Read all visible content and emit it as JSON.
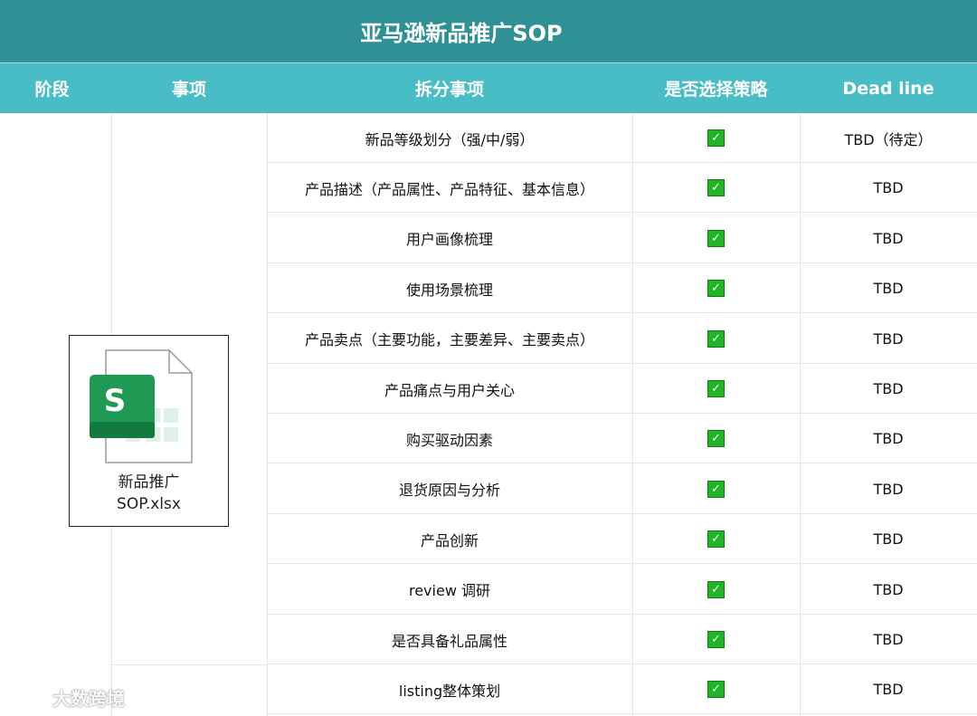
{
  "title": "亚马逊新品推广SOP",
  "headers": {
    "stage": "阶段",
    "item": "事项",
    "subtask": "拆分事项",
    "strategy": "是否选择策略",
    "deadline": "Dead line"
  },
  "rows": [
    {
      "task": "新品等级划分（强/中/弱）",
      "checked": true,
      "deadline": "TBD（待定）"
    },
    {
      "task": "产品描述（产品属性、产品特征、基本信息）",
      "checked": true,
      "deadline": "TBD"
    },
    {
      "task": "用户画像梳理",
      "checked": true,
      "deadline": "TBD"
    },
    {
      "task": "使用场景梳理",
      "checked": true,
      "deadline": "TBD"
    },
    {
      "task": "产品卖点（主要功能，主要差异、主要卖点）",
      "checked": true,
      "deadline": "TBD"
    },
    {
      "task": "产品痛点与用户关心",
      "checked": true,
      "deadline": "TBD"
    },
    {
      "task": "购买驱动因素",
      "checked": true,
      "deadline": "TBD"
    },
    {
      "task": "退货原因与分析",
      "checked": true,
      "deadline": "TBD"
    },
    {
      "task": "产品创新",
      "checked": true,
      "deadline": "TBD"
    },
    {
      "task": "review 调研",
      "checked": true,
      "deadline": "TBD"
    },
    {
      "task": "是否具备礼品属性",
      "checked": true,
      "deadline": "TBD"
    },
    {
      "task": "listing整体策划",
      "checked": true,
      "deadline": "TBD"
    }
  ],
  "check_mark": "✓",
  "attachment": {
    "line1": "新品推广",
    "line2": "SOP.xlsx",
    "icon_letter": "S",
    "icon": "spreadsheet-file-icon"
  },
  "watermark": {
    "text": "大数跨境"
  },
  "colors": {
    "title_bg": "#2f9196",
    "header_bg": "#49bdc6",
    "check_green": "#1fb527"
  }
}
